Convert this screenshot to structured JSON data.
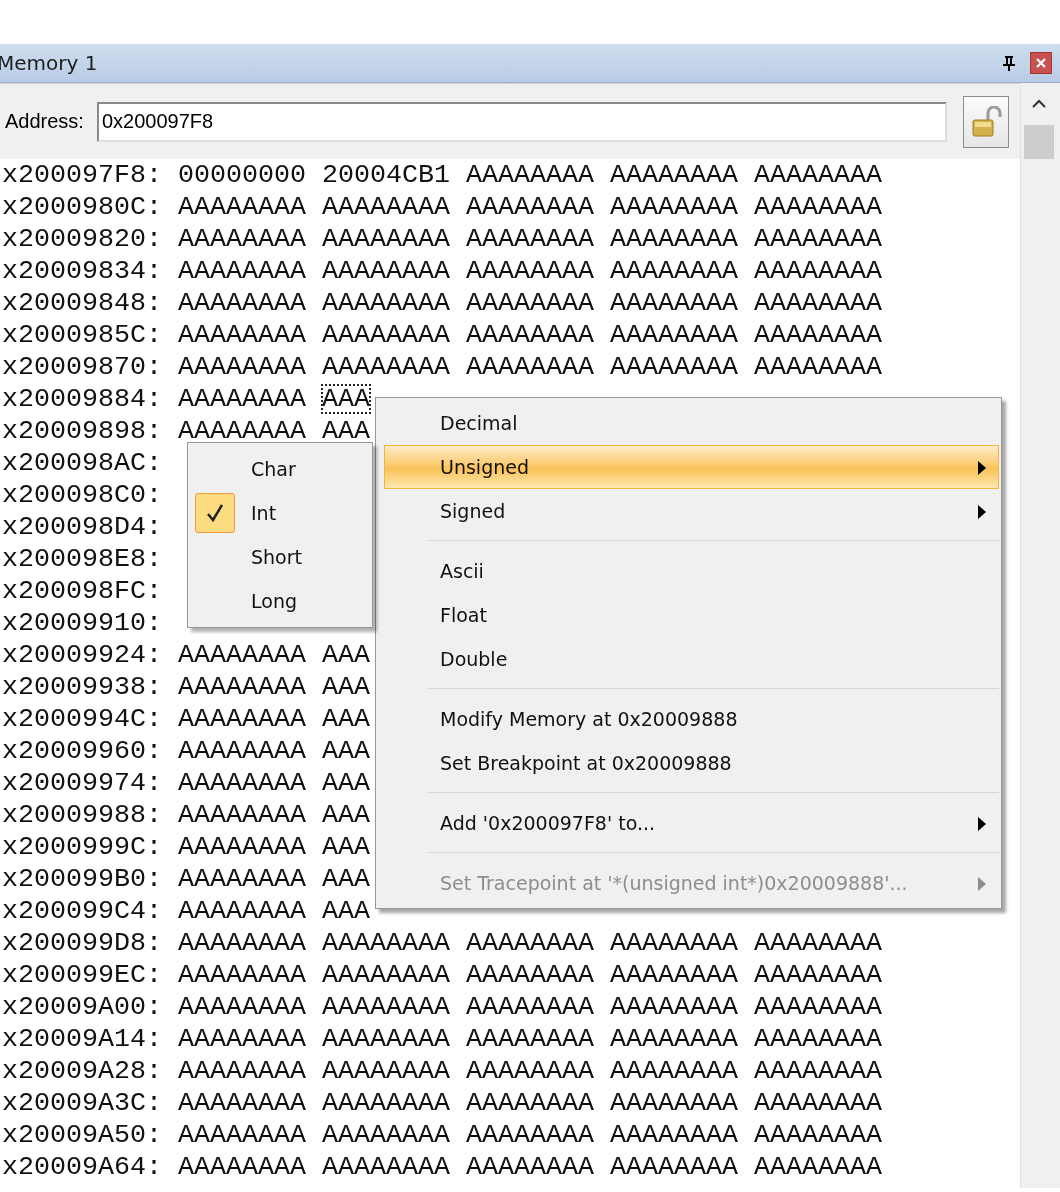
{
  "window": {
    "title": "Memory 1"
  },
  "address_bar": {
    "label": "Address:",
    "value": "0x200097F8",
    "locked": false
  },
  "rows": [
    {
      "address": "x200097F8:",
      "cells": [
        {
          "value": "00000000",
          "selected": false
        },
        {
          "value": "20004CB1",
          "selected": false
        },
        {
          "value": "AAAAAAAA",
          "selected": false
        },
        {
          "value": "AAAAAAAA",
          "selected": false
        },
        {
          "value": "AAAAAAAA",
          "selected": false
        }
      ]
    },
    {
      "address": "x2000980C:",
      "cells": [
        {
          "value": "AAAAAAAA",
          "selected": false
        },
        {
          "value": "AAAAAAAA",
          "selected": false
        },
        {
          "value": "AAAAAAAA",
          "selected": false
        },
        {
          "value": "AAAAAAAA",
          "selected": false
        },
        {
          "value": "AAAAAAAA",
          "selected": false
        }
      ]
    },
    {
      "address": "x20009820:",
      "cells": [
        {
          "value": "AAAAAAAA",
          "selected": false
        },
        {
          "value": "AAAAAAAA",
          "selected": false
        },
        {
          "value": "AAAAAAAA",
          "selected": false
        },
        {
          "value": "AAAAAAAA",
          "selected": false
        },
        {
          "value": "AAAAAAAA",
          "selected": false
        }
      ]
    },
    {
      "address": "x20009834:",
      "cells": [
        {
          "value": "AAAAAAAA",
          "selected": false
        },
        {
          "value": "AAAAAAAA",
          "selected": false
        },
        {
          "value": "AAAAAAAA",
          "selected": false
        },
        {
          "value": "AAAAAAAA",
          "selected": false
        },
        {
          "value": "AAAAAAAA",
          "selected": false
        }
      ]
    },
    {
      "address": "x20009848:",
      "cells": [
        {
          "value": "AAAAAAAA",
          "selected": false
        },
        {
          "value": "AAAAAAAA",
          "selected": false
        },
        {
          "value": "AAAAAAAA",
          "selected": false
        },
        {
          "value": "AAAAAAAA",
          "selected": false
        },
        {
          "value": "AAAAAAAA",
          "selected": false
        }
      ]
    },
    {
      "address": "x2000985C:",
      "cells": [
        {
          "value": "AAAAAAAA",
          "selected": false
        },
        {
          "value": "AAAAAAAA",
          "selected": false
        },
        {
          "value": "AAAAAAAA",
          "selected": false
        },
        {
          "value": "AAAAAAAA",
          "selected": false
        },
        {
          "value": "AAAAAAAA",
          "selected": false
        }
      ]
    },
    {
      "address": "x20009870:",
      "cells": [
        {
          "value": "AAAAAAAA",
          "selected": false
        },
        {
          "value": "AAAAAAAA",
          "selected": false
        },
        {
          "value": "AAAAAAAA",
          "selected": false
        },
        {
          "value": "AAAAAAAA",
          "selected": false
        },
        {
          "value": "AAAAAAAA",
          "selected": false
        }
      ]
    },
    {
      "address": "x20009884:",
      "cells": [
        {
          "value": "AAAAAAAA",
          "selected": false
        },
        {
          "value": "AAA",
          "selected": true
        }
      ]
    },
    {
      "address": "x20009898:",
      "cells": [
        {
          "value": "AAAAAAAA",
          "selected": false
        },
        {
          "value": "AAA",
          "selected": false
        }
      ]
    },
    {
      "address": "x200098AC:"
    },
    {
      "address": "x200098C0:"
    },
    {
      "address": "x200098D4:"
    },
    {
      "address": "x200098E8:"
    },
    {
      "address": "x200098FC:"
    },
    {
      "address": "x20009910:"
    },
    {
      "address": "x20009924:",
      "cells": [
        {
          "value": "AAAAAAAA",
          "selected": false
        },
        {
          "value": "AAA",
          "selected": false
        }
      ]
    },
    {
      "address": "x20009938:",
      "cells": [
        {
          "value": "AAAAAAAA",
          "selected": false
        },
        {
          "value": "AAA",
          "selected": false
        }
      ]
    },
    {
      "address": "x2000994C:",
      "cells": [
        {
          "value": "AAAAAAAA",
          "selected": false
        },
        {
          "value": "AAA",
          "selected": false
        }
      ]
    },
    {
      "address": "x20009960:",
      "cells": [
        {
          "value": "AAAAAAAA",
          "selected": false
        },
        {
          "value": "AAA",
          "selected": false
        }
      ]
    },
    {
      "address": "x20009974:",
      "cells": [
        {
          "value": "AAAAAAAA",
          "selected": false
        },
        {
          "value": "AAA",
          "selected": false
        }
      ]
    },
    {
      "address": "x20009988:",
      "cells": [
        {
          "value": "AAAAAAAA",
          "selected": false
        },
        {
          "value": "AAA",
          "selected": false
        }
      ]
    },
    {
      "address": "x2000999C:",
      "cells": [
        {
          "value": "AAAAAAAA",
          "selected": false
        },
        {
          "value": "AAA",
          "selected": false
        }
      ]
    },
    {
      "address": "x200099B0:",
      "cells": [
        {
          "value": "AAAAAAAA",
          "selected": false
        },
        {
          "value": "AAA",
          "selected": false
        }
      ]
    },
    {
      "address": "x200099C4:",
      "cells": [
        {
          "value": "AAAAAAAA",
          "selected": false
        },
        {
          "value": "AAA",
          "selected": false
        }
      ]
    },
    {
      "address": "x200099D8:",
      "cells": [
        {
          "value": "AAAAAAAA",
          "selected": false
        },
        {
          "value": "AAAAAAAA",
          "selected": false
        },
        {
          "value": "AAAAAAAA",
          "selected": false
        },
        {
          "value": "AAAAAAAA",
          "selected": false
        },
        {
          "value": "AAAAAAAA",
          "selected": false
        }
      ]
    },
    {
      "address": "x200099EC:",
      "cells": [
        {
          "value": "AAAAAAAA",
          "selected": false
        },
        {
          "value": "AAAAAAAA",
          "selected": false
        },
        {
          "value": "AAAAAAAA",
          "selected": false
        },
        {
          "value": "AAAAAAAA",
          "selected": false
        },
        {
          "value": "AAAAAAAA",
          "selected": false
        }
      ]
    },
    {
      "address": "x20009A00:",
      "cells": [
        {
          "value": "AAAAAAAA",
          "selected": false
        },
        {
          "value": "AAAAAAAA",
          "selected": false
        },
        {
          "value": "AAAAAAAA",
          "selected": false
        },
        {
          "value": "AAAAAAAA",
          "selected": false
        },
        {
          "value": "AAAAAAAA",
          "selected": false
        }
      ]
    },
    {
      "address": "x20009A14:",
      "cells": [
        {
          "value": "AAAAAAAA",
          "selected": false
        },
        {
          "value": "AAAAAAAA",
          "selected": false
        },
        {
          "value": "AAAAAAAA",
          "selected": false
        },
        {
          "value": "AAAAAAAA",
          "selected": false
        },
        {
          "value": "AAAAAAAA",
          "selected": false
        }
      ]
    },
    {
      "address": "x20009A28:",
      "cells": [
        {
          "value": "AAAAAAAA",
          "selected": false
        },
        {
          "value": "AAAAAAAA",
          "selected": false
        },
        {
          "value": "AAAAAAAA",
          "selected": false
        },
        {
          "value": "AAAAAAAA",
          "selected": false
        },
        {
          "value": "AAAAAAAA",
          "selected": false
        }
      ]
    },
    {
      "address": "x20009A3C:",
      "cells": [
        {
          "value": "AAAAAAAA",
          "selected": false
        },
        {
          "value": "AAAAAAAA",
          "selected": false
        },
        {
          "value": "AAAAAAAA",
          "selected": false
        },
        {
          "value": "AAAAAAAA",
          "selected": false
        },
        {
          "value": "AAAAAAAA",
          "selected": false
        }
      ]
    },
    {
      "address": "x20009A50:",
      "cells": [
        {
          "value": "AAAAAAAA",
          "selected": false
        },
        {
          "value": "AAAAAAAA",
          "selected": false
        },
        {
          "value": "AAAAAAAA",
          "selected": false
        },
        {
          "value": "AAAAAAAA",
          "selected": false
        },
        {
          "value": "AAAAAAAA",
          "selected": false
        }
      ]
    },
    {
      "address": "x20009A64:",
      "cells": [
        {
          "value": "AAAAAAAA",
          "selected": false
        },
        {
          "value": "AAAAAAAA",
          "selected": false
        },
        {
          "value": "AAAAAAAA",
          "selected": false
        },
        {
          "value": "AAAAAAAA",
          "selected": false
        },
        {
          "value": "AAAAAAAA",
          "selected": false
        }
      ]
    }
  ],
  "context_menu": {
    "items": [
      {
        "kind": "item",
        "label": "Decimal",
        "selected": false,
        "submenu": false,
        "disabled": false
      },
      {
        "kind": "item",
        "label": "Unsigned",
        "selected": true,
        "submenu": true,
        "disabled": false
      },
      {
        "kind": "item",
        "label": "Signed",
        "selected": false,
        "submenu": true,
        "disabled": false
      },
      {
        "kind": "separator"
      },
      {
        "kind": "item",
        "label": "Ascii",
        "selected": false,
        "submenu": false,
        "disabled": false
      },
      {
        "kind": "item",
        "label": "Float",
        "selected": false,
        "submenu": false,
        "disabled": false
      },
      {
        "kind": "item",
        "label": "Double",
        "selected": false,
        "submenu": false,
        "disabled": false
      },
      {
        "kind": "separator"
      },
      {
        "kind": "item",
        "label": "Modify Memory at 0x20009888",
        "selected": false,
        "submenu": false,
        "disabled": false
      },
      {
        "kind": "item",
        "label": "Set Breakpoint at 0x20009888",
        "selected": false,
        "submenu": false,
        "disabled": false
      },
      {
        "kind": "separator"
      },
      {
        "kind": "item",
        "label": "Add '0x200097F8' to...",
        "selected": false,
        "submenu": true,
        "disabled": false
      },
      {
        "kind": "separator"
      },
      {
        "kind": "item",
        "label": "Set Tracepoint at '*(unsigned int*)0x20009888'...",
        "selected": false,
        "submenu": true,
        "disabled": true
      }
    ]
  },
  "submenu": {
    "items": [
      {
        "label": "Char",
        "checked": false
      },
      {
        "label": "Int",
        "checked": true
      },
      {
        "label": "Short",
        "checked": false
      },
      {
        "label": "Long",
        "checked": false
      }
    ]
  }
}
